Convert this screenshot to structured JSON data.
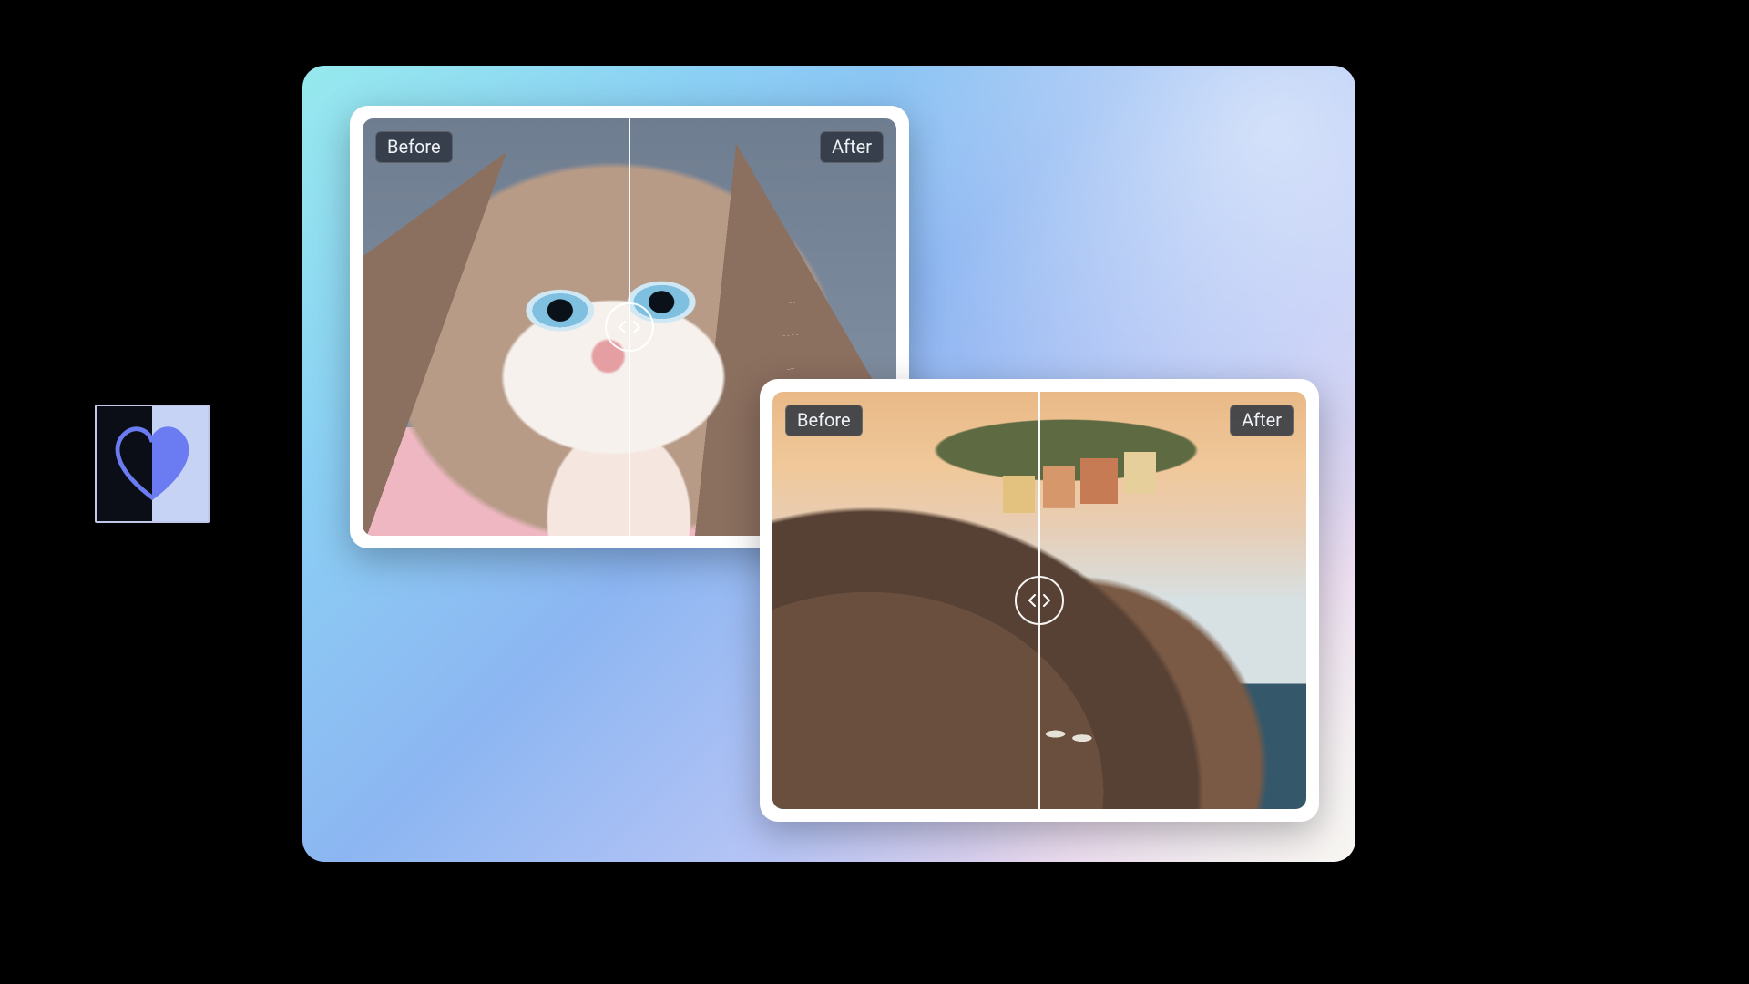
{
  "labels": {
    "before": "Before",
    "after": "After"
  },
  "cards": {
    "cat": {
      "subject": "ragdoll-cat-portrait",
      "slider_position_pct": 50
    },
    "coast": {
      "subject": "coastal-village-sunset",
      "slider_position_pct": 50
    }
  },
  "colors": {
    "badge_bg": "#2c343e",
    "panel_gradient_from": "#96e9ee",
    "panel_gradient_to": "#f1eee5",
    "heart_fill": "#6b7cf2"
  }
}
